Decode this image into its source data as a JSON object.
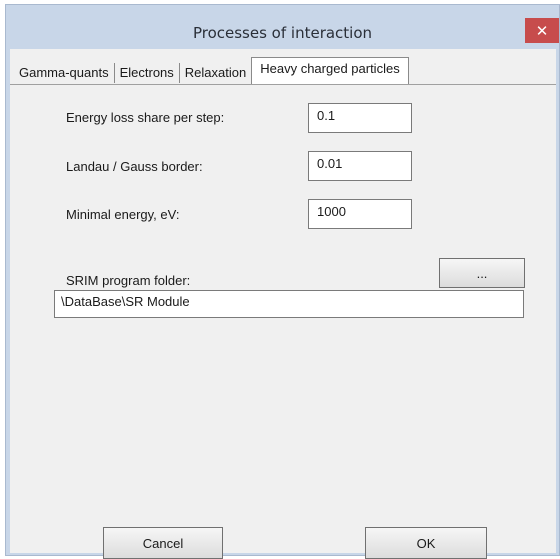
{
  "window": {
    "title": "Processes of interaction",
    "close_glyph": "✕"
  },
  "tabs": [
    {
      "label": "Gamma-quants"
    },
    {
      "label": "Electrons"
    },
    {
      "label": "Relaxation"
    },
    {
      "label": "Heavy charged particles",
      "active": true
    }
  ],
  "form": {
    "energy_loss_label": "Energy loss share per step:",
    "energy_loss_value": "0.1",
    "landau_label": "Landau / Gauss border:",
    "landau_value": "0.01",
    "min_energy_label": "Minimal energy, eV:",
    "min_energy_value": "1000",
    "srim_label": "SRIM program folder:",
    "browse_label": "...",
    "srim_path": "\\DataBase\\SR Module"
  },
  "footer": {
    "cancel_label": "Cancel",
    "ok_label": "OK"
  }
}
